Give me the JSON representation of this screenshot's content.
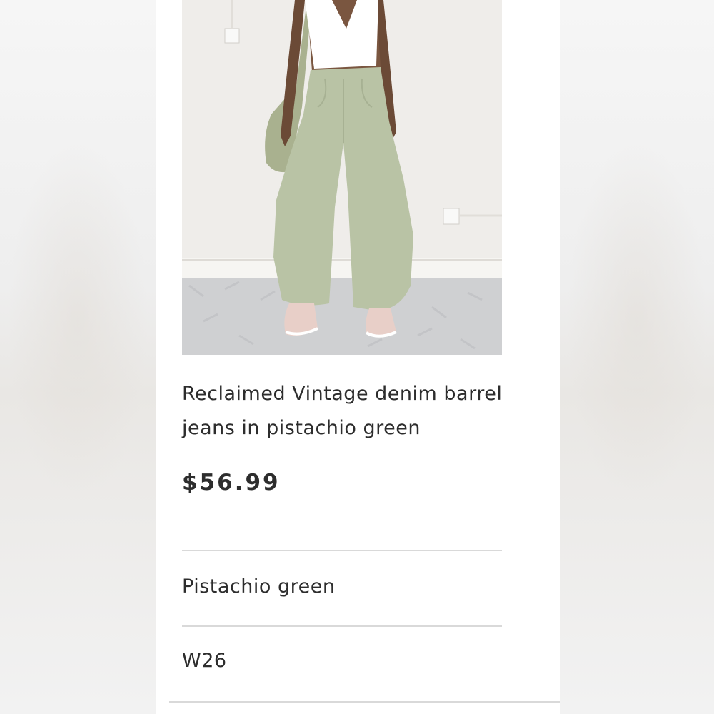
{
  "product": {
    "title": "Reclaimed Vintage denim barrel jeans in pistachio green",
    "price": "$56.99",
    "color": "Pistachio green",
    "size": "W26"
  },
  "colors": {
    "jeans": "#b9c3a5",
    "price_text": "#2d2d2d",
    "divider": "#d9d9d9"
  }
}
